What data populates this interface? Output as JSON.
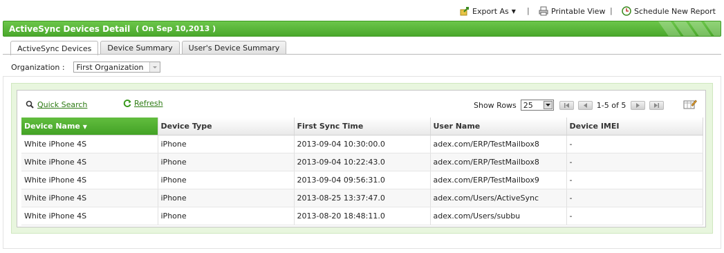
{
  "top_actions": {
    "export": "Export As",
    "printable": "Printable View",
    "schedule": "Schedule New Report",
    "separator": "|"
  },
  "header": {
    "title": "ActiveSync Devices Detail",
    "date": "( On Sep 10,2013 )"
  },
  "tabs": [
    {
      "label": "ActiveSync Devices",
      "active": true
    },
    {
      "label": "Device Summary",
      "active": false
    },
    {
      "label": "User's Device Summary",
      "active": false
    }
  ],
  "organization": {
    "label": "Organization :",
    "value": "First Organization"
  },
  "toolbar": {
    "quick_search": "Quick Search",
    "refresh": "Refresh",
    "show_rows_label": "Show Rows",
    "show_rows_value": "25",
    "page_info": "1-5 of 5"
  },
  "table": {
    "columns": [
      "Device Name",
      "Device Type",
      "First Sync Time",
      "User Name",
      "Device IMEI"
    ],
    "rows": [
      [
        "White iPhone 4S",
        "iPhone",
        "2013-09-04 10:30:00.0",
        "adex.com/ERP/TestMailbox8",
        "-"
      ],
      [
        "White iPhone 4S",
        "iPhone",
        "2013-09-04 10:22:43.0",
        "adex.com/ERP/TestMailbox8",
        "-"
      ],
      [
        "White iPhone 4S",
        "iPhone",
        "2013-09-04 09:56:31.0",
        "adex.com/ERP/TestMailbox9",
        "-"
      ],
      [
        "White iPhone 4S",
        "iPhone",
        "2013-08-25 13:37:47.0",
        "adex.com/Users/ActiveSync",
        "-"
      ],
      [
        "White iPhone 4S",
        "iPhone",
        "2013-08-20 18:48:11.0",
        "adex.com/Users/subbu",
        "-"
      ]
    ]
  },
  "colors": {
    "accent_green": "#4aa82c",
    "link_green": "#2c7a12"
  }
}
